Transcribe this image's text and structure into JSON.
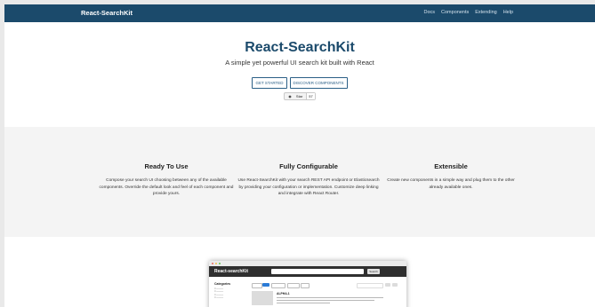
{
  "navbar": {
    "brand": "React-SearchKit",
    "links": [
      "Docs",
      "Components",
      "Extending",
      "Help"
    ]
  },
  "hero": {
    "title": "React-SearchKit",
    "subtitle": "A simple yet powerful UI search kit built with React",
    "buttons": [
      "GET STARTED",
      "DISCOVER COMPONENTS"
    ],
    "star_label": "Star",
    "star_count": "57"
  },
  "features": [
    {
      "title": "Ready To Use",
      "text": "Compose your search UI choosing between any of the available components. Override the default look and feel of each component and provide yours."
    },
    {
      "title": "Fully Configurable",
      "text": "Use React-SearchKit with your search REST API endpoint or Elasticsearch by providing your configuration or implementation. Customize deep linking and integrate with React Router."
    },
    {
      "title": "Extensible",
      "text": "Create new components in a simple way and plug them to the other already available ones."
    }
  ],
  "preview": {
    "brand": "React-searchKit",
    "search_button": "Search",
    "sidebar_title": "Categories",
    "result_title": "ALPHA-1"
  },
  "colors": {
    "navbar": "#1b4a6b",
    "accent": "#2b5f86",
    "features_bg": "#f4f4f4"
  }
}
